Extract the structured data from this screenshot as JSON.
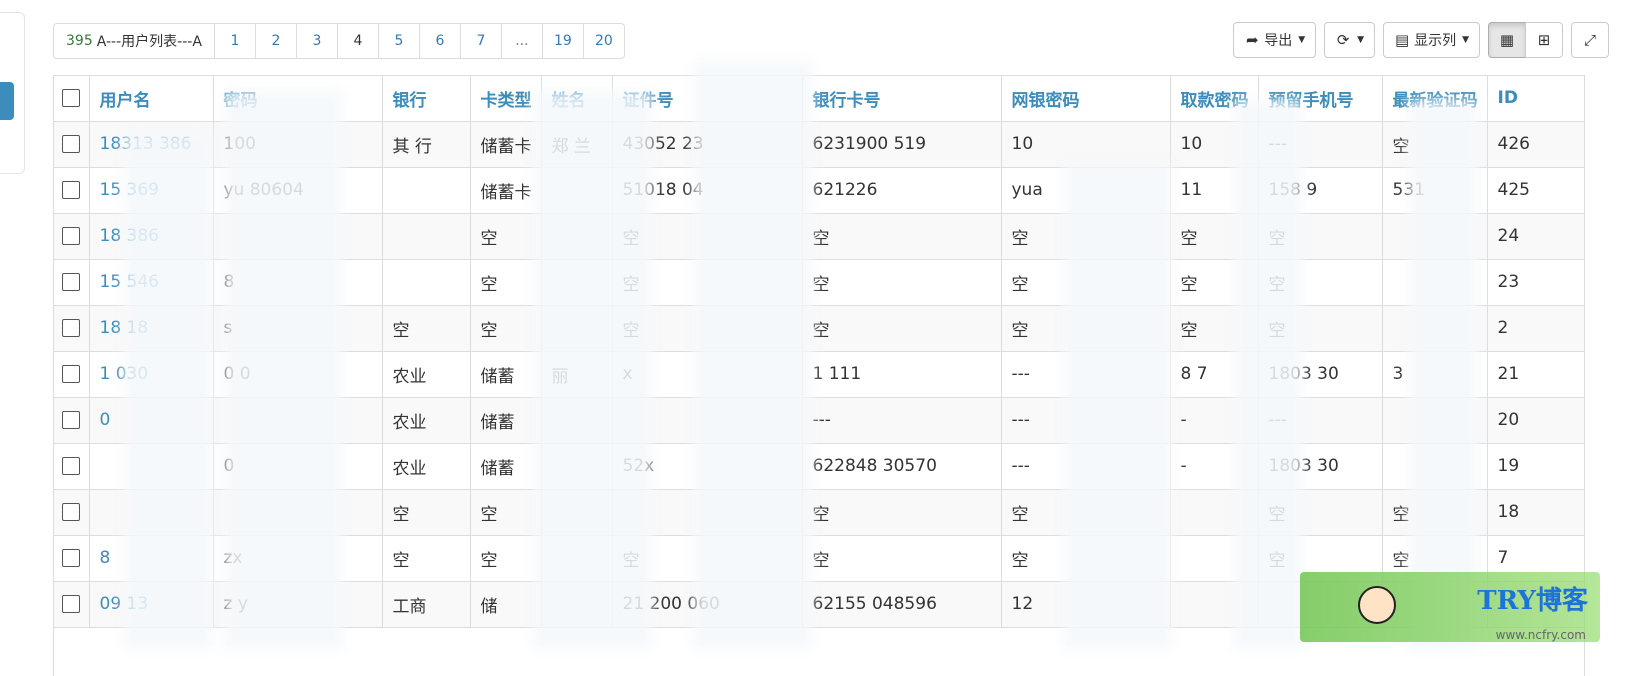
{
  "pager": {
    "total": "395",
    "total_label": "A---用户列表---A",
    "pages": [
      "1",
      "2",
      "3",
      "4",
      "5",
      "6",
      "7",
      "...",
      "19",
      "20"
    ],
    "active_page": "4"
  },
  "toolbar": {
    "export_label": "导出",
    "columns_label": "显示列"
  },
  "table": {
    "headers": [
      "用户名",
      "密码",
      "银行",
      "卡类型",
      "姓名",
      "证件号",
      "银行卡号",
      "网银密码",
      "取款密码",
      "预留手机号",
      "最新验证码",
      "ID"
    ],
    "rows": [
      [
        "18313",
        "386",
        "100",
        "其",
        "行",
        "储蓄卡",
        "郑",
        "兰",
        "430521",
        "23",
        "6231900",
        "519",
        "10",
        "10",
        "---",
        "空",
        "426"
      ],
      [
        "15",
        "369",
        "yu",
        "80604",
        "",
        "储蓄卡",
        "",
        "",
        "51018",
        "04",
        "621226",
        "",
        "yua",
        "11",
        "158",
        "531",
        "425"
      ]
    ],
    "cells": {
      "r1": {
        "user": "18313  386",
        "pwd": "100",
        "bank": "其  行",
        "type": "储蓄卡",
        "name": "郑  兰",
        "idno": "43052  23",
        "card": "6231900  519",
        "ebank": "10",
        "wpwd": "10",
        "phone": "---",
        "code": "空",
        "id": "426"
      },
      "r2": {
        "user": "15  369",
        "pwd": "yu  80604",
        "bank": "",
        "type": "储蓄卡",
        "name": "",
        "idno": "51018  04",
        "card": "621226",
        "ebank": "yua",
        "wpwd": "11",
        "phone": "158  9",
        "code": "531",
        "id": "425"
      },
      "r3": {
        "user": "18  386",
        "pwd": "",
        "bank": "",
        "type": "空",
        "name": "",
        "idno": "空",
        "card": "空",
        "ebank": "空",
        "wpwd": "空",
        "phone": "空",
        "code": "",
        "id": "24"
      },
      "r4": {
        "user": "15  546",
        "pwd": "8",
        "bank": "",
        "type": "空",
        "name": "",
        "idno": "空",
        "card": "空",
        "ebank": "空",
        "wpwd": "空",
        "phone": "空",
        "code": "",
        "id": "23"
      },
      "r5": {
        "user": "18  18",
        "pwd": "s",
        "bank": "空",
        "type": "空",
        "name": "",
        "idno": "空",
        "card": "空",
        "ebank": "空",
        "wpwd": "空",
        "phone": "空",
        "code": "",
        "id": "2"
      },
      "r6": {
        "user": "1  030",
        "pwd": "0  0",
        "bank": "农业",
        "type": "储蓄",
        "name": "丽",
        "idno": "x",
        "card": "1  111",
        "ebank": "---",
        "wpwd": "8  7",
        "phone": "1803  30",
        "code": "3",
        "id": "21"
      },
      "r7": {
        "user": "0",
        "pwd": "",
        "bank": "农业",
        "type": "储蓄",
        "name": "",
        "idno": "",
        "card": "---",
        "ebank": "---",
        "wpwd": "-",
        "phone": "---",
        "code": "",
        "id": "20"
      },
      "r8": {
        "user": "",
        "pwd": "0",
        "bank": "农业",
        "type": "储蓄",
        "name": "",
        "idno": "52x",
        "card": "622848  30570",
        "ebank": "---",
        "wpwd": "-",
        "phone": "1803  30",
        "code": "",
        "id": "19"
      },
      "r9": {
        "user": "",
        "pwd": "",
        "bank": "空",
        "type": "空",
        "name": "",
        "idno": "",
        "card": "空",
        "ebank": "空",
        "wpwd": "",
        "phone": "空",
        "code": "空",
        "id": "18"
      },
      "r10": {
        "user": "8",
        "pwd": "zx",
        "bank": "空",
        "type": "空",
        "name": "",
        "idno": "空",
        "card": "空",
        "ebank": "空",
        "wpwd": "",
        "phone": "空",
        "code": "空",
        "id": "7"
      },
      "r11": {
        "user": "09  13",
        "pwd": "z  y",
        "bank": "工商",
        "type": "储",
        "name": "",
        "idno": "21  200  060",
        "card": "62155  048596",
        "ebank": "12",
        "wpwd": "",
        "phone": "",
        "code": "",
        "id": ""
      }
    }
  },
  "watermark": {
    "text": "TRY博客",
    "url": "www.ncfry.com"
  }
}
